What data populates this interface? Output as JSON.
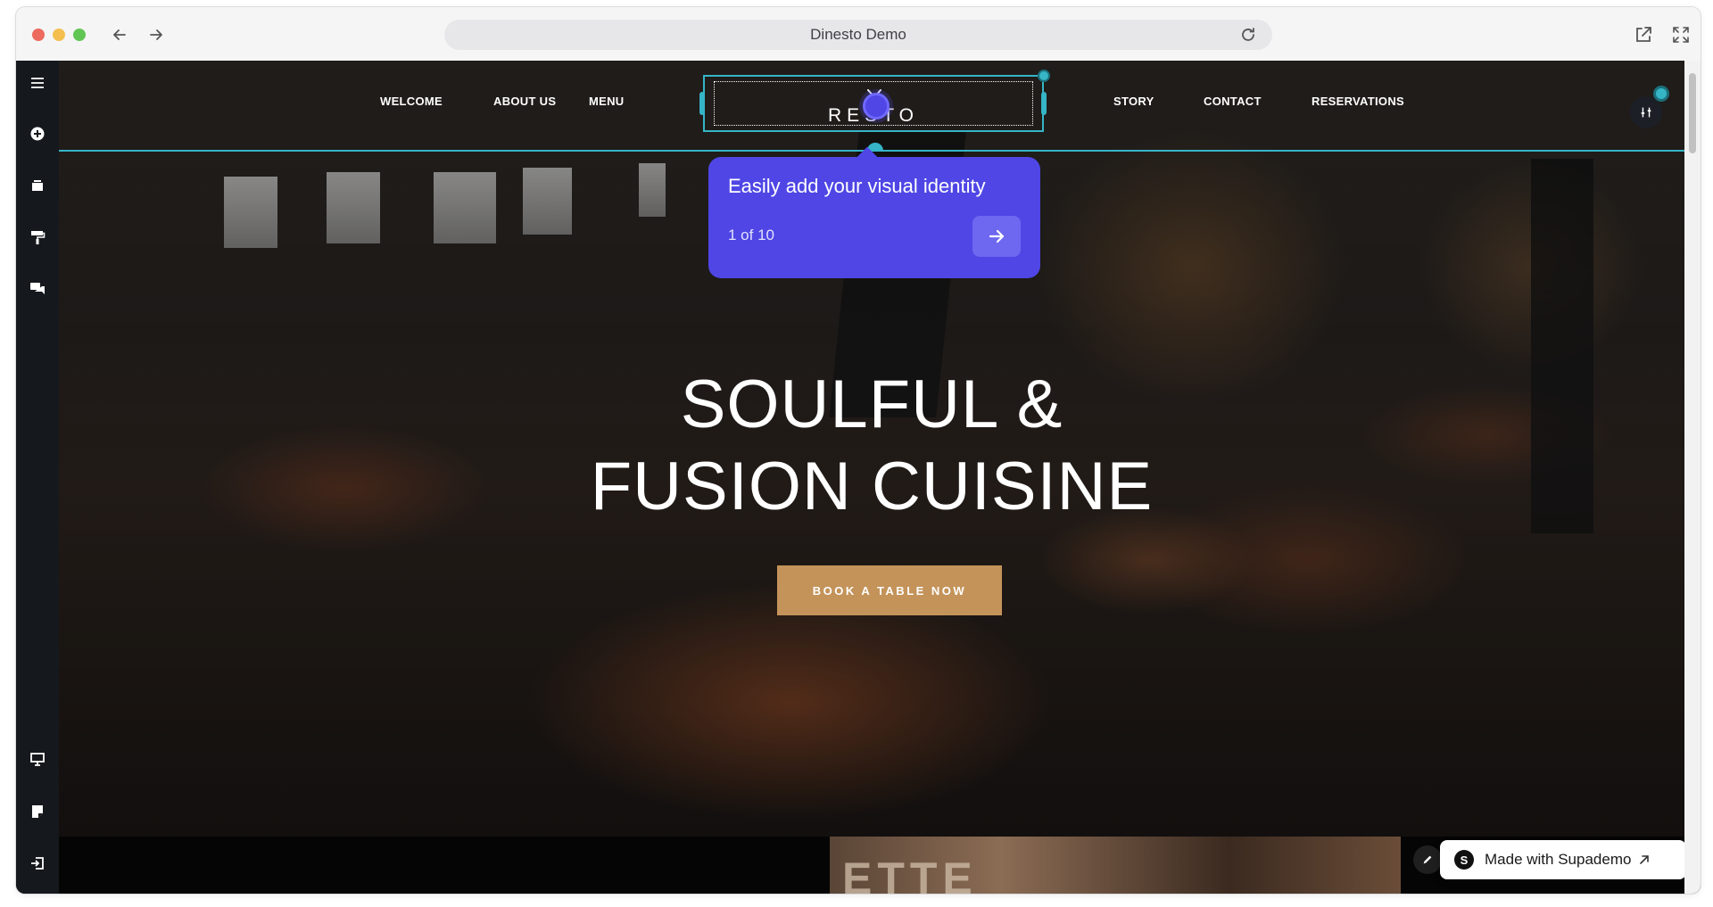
{
  "browser": {
    "title": "Dinesto Demo"
  },
  "site": {
    "nav": {
      "welcome": "WELCOME",
      "about": "ABOUT US",
      "menu": "MENU",
      "logo": "RESTO",
      "story": "STORY",
      "contact": "CONTACT",
      "reservations": "RESERVATIONS"
    },
    "hero": {
      "line1": "SOULFUL &",
      "line2": "FUSION CUISINE",
      "cta": "BOOK A TABLE NOW"
    }
  },
  "tour": {
    "title": "Easily add your visual identity",
    "step": "1 of 10"
  },
  "badge": {
    "label": "Made with Supademo",
    "logo_letter": "S"
  },
  "sidebar_icons": [
    "menu-icon",
    "add-icon",
    "layers-icon",
    "paint-roller-icon",
    "chat-icon",
    "desktop-icon",
    "note-icon",
    "exit-icon"
  ],
  "colors": {
    "accent": "#4f46e5",
    "selection": "#35b5c6",
    "cta": "#c4935a",
    "sidebar": "#15181d"
  }
}
